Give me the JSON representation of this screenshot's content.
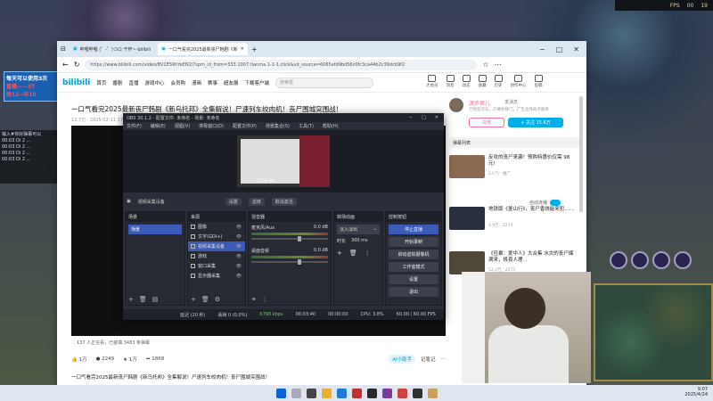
{
  "game": {
    "fps_label": "FPS",
    "fps_value": "00",
    "clock": "19"
  },
  "overlay": {
    "line1": "每天可以使用3次",
    "line2": "直播——3T",
    "line3": "晚12→早10",
    "bili_text": "Bilibili"
  },
  "chat": {
    "line1": "输入#你好弹幕可以",
    "line2": "00:03 Di 2 ...",
    "line3": "00:03 Di 2 ...",
    "line4": "00:03 Di 2 ...",
    "line5": "00:03 Di 2 ..."
  },
  "browser": {
    "tab1": "哔哩哔哩 (゜-゜)つロ 干杯~-bilibili",
    "tab2": "一口气看完2025最新丧尸韩剧《新",
    "url": "https://www.bilibili.com/video/BV1ES9hYeEN2/?spm_id_from=333.1007.tianma.1-1-1.click&vd_source=6065efd9bd56c0fc3ca44b2c39dcb9f2",
    "nav": [
      "首页",
      "番剧",
      "直播",
      "游戏中心",
      "会员购",
      "漫画",
      "赛事",
      "超友展",
      "下载客户端"
    ],
    "search_placeholder": "搜索框",
    "header_icons": [
      "大会员",
      "消息",
      "动态",
      "收藏",
      "历史",
      "创作中心",
      "投稿"
    ]
  },
  "video": {
    "title": "一口气看完2025最新丧尸韩剧《新乌托邦》全集解说！尸速列车绞肉机！丧尸围城突围战！",
    "stats": "13.7万  · 2025-02-11 17:00:00",
    "danmaku_info": "137 人正在看，已装填 3483 条弹幕",
    "likes": "1万",
    "coins": "2249",
    "favs": "1万",
    "shares": "1868",
    "ai_btn": "AI小助手",
    "report": "记笔记",
    "desc": "一口气看完2025最新丧尸韩剧《新乌托邦》全集解说！尸速列车绞肉机！丧尸围城突围战！"
  },
  "up": {
    "name": "渡步君儿",
    "msg": "发消息",
    "desc": "万物皆可乐，只要你够门，广告合作商务联系",
    "charge": "充电",
    "follow": "+ 关注 15.6万",
    "danmaku_list": "弹幕列表"
  },
  "recommend": [
    {
      "title": "反攻的丧尸来袭！预购特惠价仅需 98 元!",
      "meta": "2人气 · 推广"
    },
    {
      "title": "地铁版《釜山行》，丧尸香烧能来犯……",
      "meta": "1.9万 · 2274"
    },
    {
      "title": "《狂暴：爱中人》大合集 水灾的丧尸爆满来，极喜人理...",
      "meta": "52.3万 · 2275"
    }
  ],
  "autoplay": "自动连播",
  "obs": {
    "title": "OBS 30.1.2 - 配置文件: 未命名 - 场景: 未命名",
    "menu": [
      "文件(F)",
      "编辑(E)",
      "视图(V)",
      "停靠窗口(D)",
      "配置文件(P)",
      "场景集合(S)",
      "工具(T)",
      "帮助(H)"
    ],
    "preview_res": "1250 px",
    "toolbar": [
      "视频采集设备",
      "设置",
      "滤镜",
      "取消激活"
    ],
    "scenes_title": "场景",
    "scene": "场景",
    "sources_title": "来源",
    "sources": [
      "图像",
      "文字(GDI+)",
      "视频采集设备",
      "游戏",
      "窗口采集",
      "显示器采集"
    ],
    "mixer_title": "混音器",
    "mixer": [
      {
        "name": "麦克风/Aux",
        "db": "0.0 dB"
      },
      {
        "name": "桌面音频",
        "db": "0.0 dB"
      }
    ],
    "transitions_title": "转场动画",
    "transition": "淡入淡出",
    "duration_label": "时长",
    "duration": "300 ms",
    "controls_title": "控制按钮",
    "controls": [
      "停止直播",
      "开始录制",
      "启动虚拟摄像机",
      "工作室模式",
      "设置",
      "退出"
    ],
    "status": [
      "延迟 (20 秒)",
      "丢帧 0 (0.0%)",
      "6798 kbps",
      "00:03:40",
      "00:00:00",
      "CPU: 3.8%",
      "60.00 / 60.00 FPS"
    ]
  },
  "taskbar": {
    "time": "9:07",
    "date": "2025/4/24"
  },
  "colors": {
    "bili_blue": "#00a1d6",
    "bili_pink": "#fb7299",
    "obs_bg": "#2b2e38",
    "obs_select": "#3c5bb8"
  }
}
